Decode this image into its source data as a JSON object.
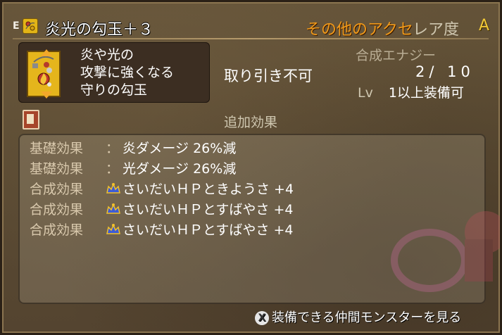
{
  "item": {
    "equip_mark": "E",
    "name": "炎光の勾玉＋３",
    "category": "その他のアクセ",
    "rarity_label": "レア度",
    "rarity": "A",
    "description_lines": [
      "炎や光の",
      "攻撃に強くなる",
      "守りの勾玉"
    ],
    "trade": "取り引き不可",
    "synth_label": "合成エナジー",
    "synth_value": "2/ 10",
    "level_prefix": "Lv",
    "level_text": "1以上装備可"
  },
  "extra": {
    "label": "追加効果",
    "effects": [
      {
        "kind": "基礎効果",
        "sep": "：",
        "icon": "",
        "text": "炎ダメージ 26%減"
      },
      {
        "kind": "基礎効果",
        "sep": "：",
        "icon": "",
        "text": "光ダメージ 26%減"
      },
      {
        "kind": "合成効果",
        "sep": "",
        "icon": "crown-icon",
        "text": "さいだいＨＰときようさ +4"
      },
      {
        "kind": "合成効果",
        "sep": "",
        "icon": "crown-icon",
        "text": "さいだいＨＰとすばやさ +4"
      },
      {
        "kind": "合成効果",
        "sep": "",
        "icon": "crown-icon",
        "text": "さいだいＨＰとすばやさ +4"
      }
    ]
  },
  "footer": {
    "button_glyph": "X",
    "action": "装備できる仲間モンスターを見る"
  },
  "colors": {
    "category": "#f19a1a",
    "rarity": "#f0c838",
    "panel": "#3c2e22",
    "icon_gold": "#e5b51c"
  }
}
